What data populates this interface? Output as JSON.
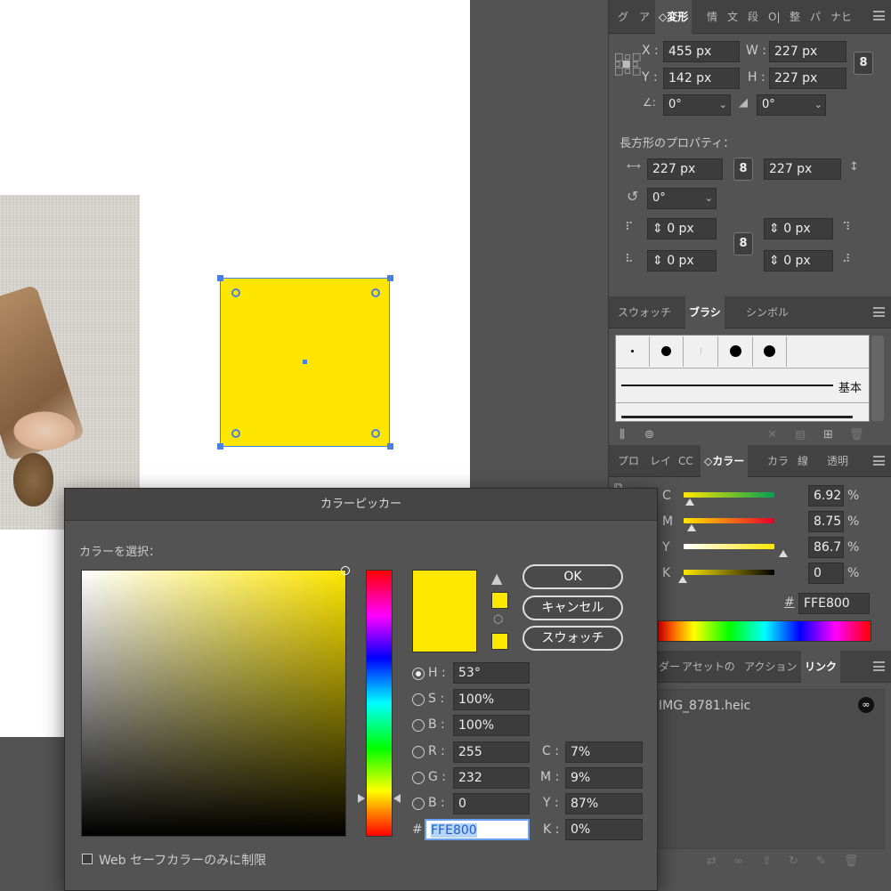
{
  "colors": {
    "fill": "#FFE600",
    "accent": "#4a7fe0"
  },
  "transform_panel": {
    "tabs": [
      "グ",
      "ア",
      "変形",
      "情",
      "文",
      "段",
      "O|",
      "整",
      "パ",
      "ナヒ"
    ],
    "active_tab": "変形",
    "x_label": "X :",
    "x_value": "455 px",
    "y_label": "Y :",
    "y_value": "142 px",
    "w_label": "W :",
    "w_value": "227 px",
    "h_label": "H :",
    "h_value": "227 px",
    "angle_label": "∠:",
    "angle_value": "0°",
    "shear_value": "0°",
    "rect_props_title": "長方形のプロパティ：",
    "rect_w": "227 px",
    "rect_h": "227 px",
    "rect_rotation": "0°",
    "corner_tl": "0 px",
    "corner_tr": "0 px",
    "corner_bl": "0 px",
    "corner_br": "0 px"
  },
  "brush_panel": {
    "tabs": [
      "スウォッチ",
      "ブラシ",
      "シンボル"
    ],
    "active_tab": "ブラシ",
    "basic_label": "基本"
  },
  "color_panel": {
    "tabs": [
      "プロ",
      "レイ",
      "CC",
      "カラー",
      "カラ",
      "線",
      "透明"
    ],
    "active_tab": "カラー",
    "c_label": "C",
    "m_label": "M",
    "y_label": "Y",
    "k_label": "K",
    "c_value": "6.92",
    "m_value": "8.75",
    "y_value": "86.7",
    "k_value": "0",
    "pct": "%",
    "hash": "#",
    "hex_value": "FFE800"
  },
  "links_panel": {
    "tabs": [
      "ダー",
      "アセットの",
      "アクション",
      "リンク"
    ],
    "active_tab": "リンク",
    "file_name": "IMG_8781.heic"
  },
  "color_picker": {
    "title": "カラーピッカー",
    "select_label": "カラーを選択：",
    "ok_label": "OK",
    "cancel_label": "キャンセル",
    "swatch_label": "スウォッチ",
    "h_label": "H :",
    "h_value": "53°",
    "s_label": "S :",
    "s_value": "100%",
    "b_label": "B :",
    "b_value": "100%",
    "r_label": "R :",
    "r_value": "255",
    "g_label": "G :",
    "g_value": "232",
    "bl_label": "B :",
    "bl_value": "0",
    "c_label": "C :",
    "c_value": "7%",
    "m_label": "M :",
    "m_value": "9%",
    "y_label": "Y :",
    "y_value": "87%",
    "k_label": "K :",
    "k_value": "0%",
    "hash": "#",
    "hex_value": "FFE800",
    "web_safe_label": "Web セーフカラーのみに制限",
    "web_safe_checked": false
  }
}
